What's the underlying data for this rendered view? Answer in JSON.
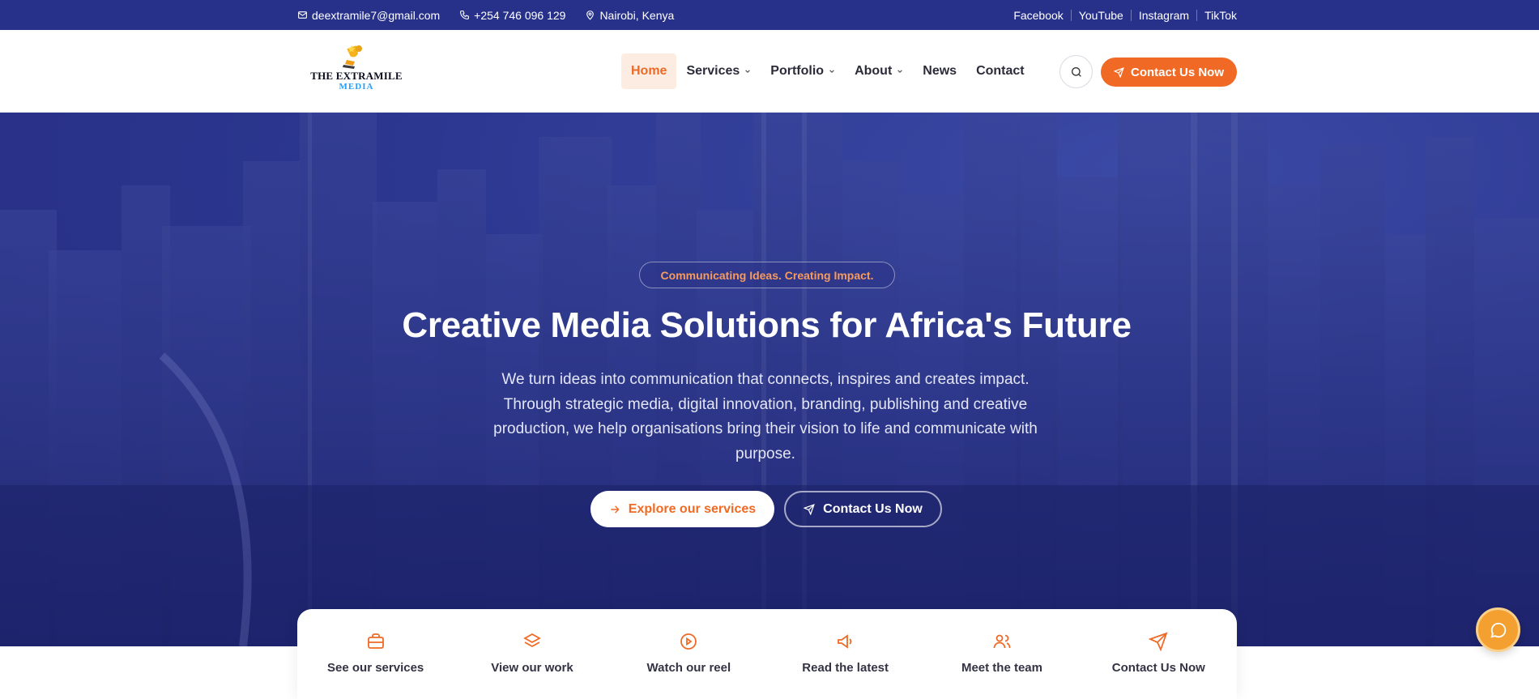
{
  "topbar": {
    "email": "deextramile7@gmail.com",
    "phone": "+254 746 096 129",
    "location": "Nairobi, Kenya",
    "social": [
      "Facebook",
      "YouTube",
      "Instagram",
      "TikTok"
    ]
  },
  "logo": {
    "line1": "THE EXTRAMILE",
    "line2": "MEDIA"
  },
  "nav": {
    "items": [
      {
        "label": "Home",
        "active": true,
        "dropdown": false
      },
      {
        "label": "Services",
        "dropdown": true
      },
      {
        "label": "Portfolio",
        "dropdown": true
      },
      {
        "label": "About",
        "dropdown": true
      },
      {
        "label": "News",
        "dropdown": false
      },
      {
        "label": "Contact",
        "dropdown": false
      }
    ],
    "cta_label": "Contact Us Now"
  },
  "hero": {
    "badge": "Communicating Ideas. Creating Impact.",
    "title": "Creative Media Solutions for Africa's Future",
    "subtitle": "We turn ideas into communication that connects, inspires and creates impact. Through strategic media, digital innovation, branding, publishing and creative production, we help organisations bring their vision to life and communicate with purpose.",
    "primary_button": "Explore our services",
    "secondary_button": "Contact Us Now"
  },
  "quick_links": [
    {
      "label": "See our services",
      "icon": "briefcase-icon"
    },
    {
      "label": "View our work",
      "icon": "layers-icon"
    },
    {
      "label": "Watch our reel",
      "icon": "play-circle-icon"
    },
    {
      "label": "Read the latest",
      "icon": "megaphone-icon"
    },
    {
      "label": "Meet the team",
      "icon": "users-icon"
    },
    {
      "label": "Contact Us Now",
      "icon": "send-icon"
    }
  ],
  "colors": {
    "brand_navy": "#27318a",
    "accent_orange": "#f06a26",
    "chat_button": "#f4a030"
  }
}
